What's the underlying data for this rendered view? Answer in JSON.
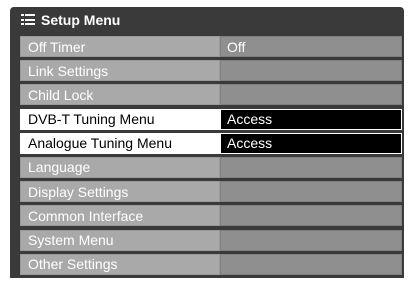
{
  "header": {
    "title": "Setup Menu",
    "icon": "menu-list-icon"
  },
  "menu_items": [
    {
      "label": "Off Timer",
      "value": "Off",
      "active": false
    },
    {
      "label": "Link Settings",
      "value": "",
      "active": false
    },
    {
      "label": "Child Lock",
      "value": "",
      "active": false
    },
    {
      "label": "DVB-T Tuning Menu",
      "value": "Access",
      "active": true
    },
    {
      "label": "Analogue Tuning Menu",
      "value": "Access",
      "active": true
    },
    {
      "label": "Language",
      "value": "",
      "active": false
    },
    {
      "label": "Display Settings",
      "value": "",
      "active": false
    },
    {
      "label": "Common Interface",
      "value": "",
      "active": false
    },
    {
      "label": "System Menu",
      "value": "",
      "active": false
    },
    {
      "label": "Other Settings",
      "value": "",
      "active": false
    }
  ],
  "colors": {
    "panel": "#3a3a3a",
    "item_label": "#a9a9a9",
    "item_value": "#8f8f8f",
    "highlight_label": "#ffffff",
    "highlight_value": "#000000"
  }
}
